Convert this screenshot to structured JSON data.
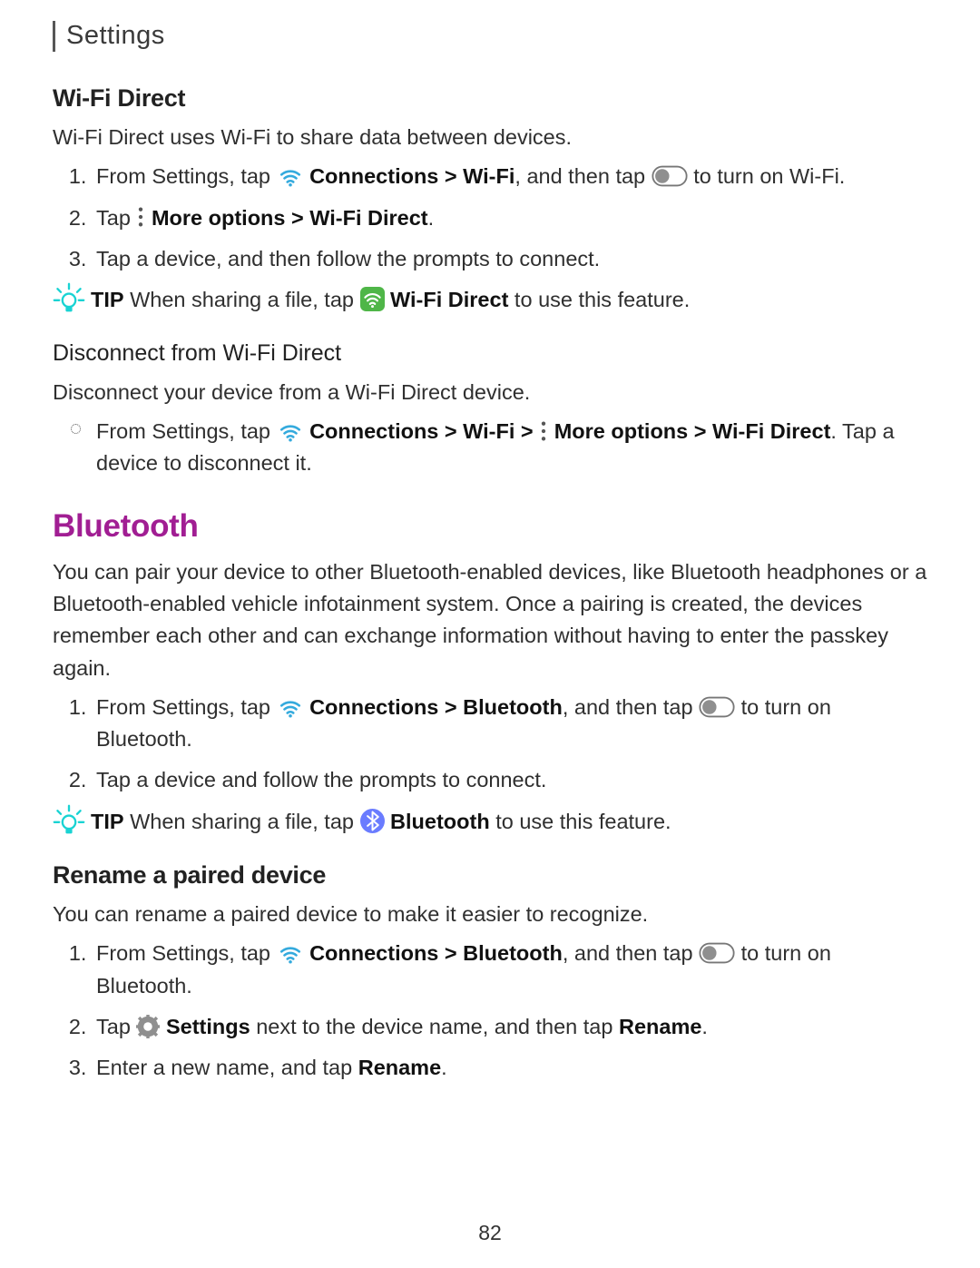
{
  "header": {
    "title": "Settings"
  },
  "wifi_direct": {
    "heading": "Wi-Fi Direct",
    "intro": "Wi-Fi Direct uses Wi-Fi to share data between devices.",
    "steps": {
      "s1_a": "From Settings, tap ",
      "s1_b": "Connections",
      "s1_c": " > ",
      "s1_d": "Wi-Fi",
      "s1_e": ", and then tap ",
      "s1_f": " to turn on Wi-Fi.",
      "s2_a": "Tap ",
      "s2_b": "More options",
      "s2_c": " > ",
      "s2_d": "Wi-Fi Direct",
      "s2_e": ".",
      "s3": "Tap a device, and then follow the prompts to connect."
    },
    "tip": {
      "label": "TIP",
      "a": "  When sharing a file, tap ",
      "b": "Wi-Fi Direct",
      "c": " to use this feature."
    },
    "disconnect": {
      "heading": "Disconnect from Wi-Fi Direct",
      "intro": "Disconnect your device from a Wi-Fi Direct device.",
      "step_a": "From Settings, tap ",
      "step_b": "Connections",
      "step_c": " > ",
      "step_d": "Wi-Fi",
      "step_e": " > ",
      "step_f": "More options",
      "step_g": " > ",
      "step_h": "Wi-Fi Direct",
      "step_i": ". Tap a device to disconnect it."
    }
  },
  "bluetooth": {
    "heading": "Bluetooth",
    "intro": "You can pair your device to other Bluetooth-enabled devices, like Bluetooth headphones or a Bluetooth-enabled vehicle infotainment system. Once a pairing is created, the devices remember each other and can exchange information without having to enter the passkey again.",
    "steps": {
      "s1_a": "From Settings, tap ",
      "s1_b": "Connections",
      "s1_c": " > ",
      "s1_d": "Bluetooth",
      "s1_e": ", and then tap ",
      "s1_f": " to turn on Bluetooth.",
      "s2": "Tap a device and follow the prompts to connect."
    },
    "tip": {
      "label": "TIP",
      "a": "  When sharing a file, tap ",
      "b": "Bluetooth",
      "c": " to use this feature."
    }
  },
  "rename": {
    "heading": "Rename a paired device",
    "intro": "You can rename a paired device to make it easier to recognize.",
    "steps": {
      "s1_a": "From Settings, tap ",
      "s1_b": "Connections",
      "s1_c": " > ",
      "s1_d": "Bluetooth",
      "s1_e": ", and then tap ",
      "s1_f": " to turn on Bluetooth.",
      "s2_a": "Tap ",
      "s2_b": "Settings",
      "s2_c": " next to the device name, and then tap ",
      "s2_d": "Rename",
      "s2_e": ".",
      "s3_a": "Enter a new name, and tap ",
      "s3_b": "Rename",
      "s3_c": "."
    }
  },
  "page_number": "82"
}
